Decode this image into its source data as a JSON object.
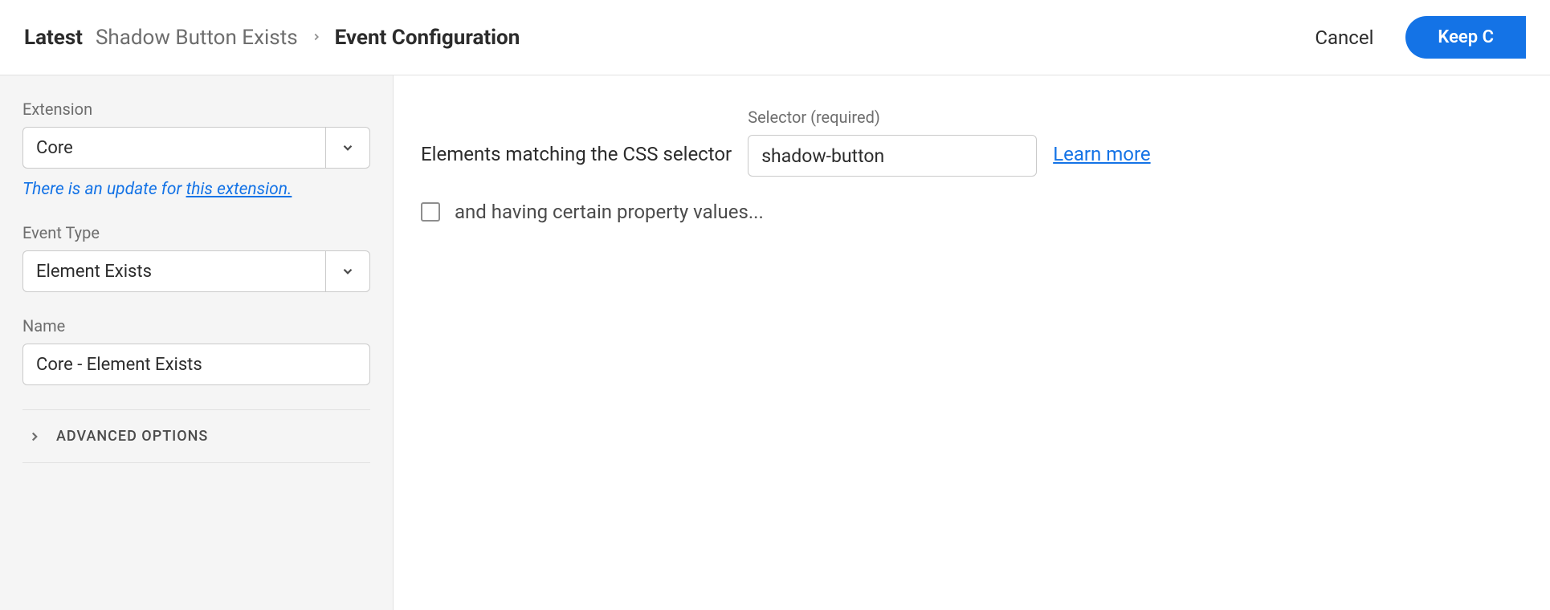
{
  "header": {
    "latest": "Latest",
    "breadcrumb_prev": "Shadow Button Exists",
    "breadcrumb_current": "Event Configuration",
    "cancel": "Cancel",
    "keep": "Keep C"
  },
  "sidebar": {
    "extension_label": "Extension",
    "extension_value": "Core",
    "update_note_prefix": "There is an update for ",
    "update_note_link": "this extension.",
    "event_type_label": "Event Type",
    "event_type_value": "Element Exists",
    "name_label": "Name",
    "name_value": "Core - Element Exists",
    "advanced_options": "ADVANCED OPTIONS"
  },
  "main": {
    "elements_matching": "Elements matching the CSS selector",
    "selector_label": "Selector (required)",
    "selector_value": "shadow-button",
    "learn_more": "Learn more",
    "property_values_label": "and having certain property values..."
  }
}
